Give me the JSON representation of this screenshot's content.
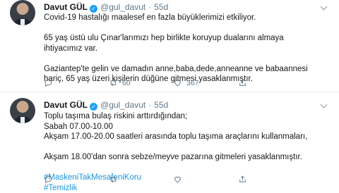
{
  "tweets": [
    {
      "author_name": "Davut GÜL",
      "handle": "@gul_davut",
      "dot": "·",
      "time": "55d",
      "lines": [
        "Covid-19 hastalığı maalesef en fazla büyüklerimizi etkiliyor.",
        "",
        "65 yaş üstü ulu Çınar'larımızı hep birlikte koruyup dualarını almaya",
        "ihtiyacımız var.",
        "",
        "Gaziantep'te gelin ve damadın anne,baba,dede,anneanne ve babaannesi",
        "hariç, 65 yaş üzeri kişilerin düğüne gitmesi yasaklanmıştır."
      ],
      "hashtags": [],
      "actions": {
        "reply_count": "",
        "retweet_count": "60",
        "like_count": "367"
      }
    },
    {
      "author_name": "Davut GÜL",
      "handle": "@gul_davut",
      "dot": "·",
      "time": "55d",
      "lines": [
        "Toplu taşıma bulaş riskini arttırdığından;",
        "Sabah 07.00-10.00",
        "Akşam 17.00-20.00 saatleri arasında toplu taşıma araçlarını kullanmaları,",
        "",
        "Akşam 18.00'dan sonra sebze/meyve pazarına gitmeleri yasaklanmıştır.",
        ""
      ],
      "hashtags": [
        "#MaskeniTakMesafeniKoru",
        "#Temizlik"
      ],
      "actions": {
        "reply_count": "",
        "retweet_count": "",
        "like_count": ""
      }
    }
  ],
  "icons": {
    "verified": "verified-badge-icon",
    "reply": "reply-icon",
    "retweet": "retweet-icon",
    "like": "heart-icon",
    "share": "share-icon",
    "more": "chevron-down-icon"
  },
  "colors": {
    "link": "#1b95e0",
    "meta": "#657786",
    "verified": "#1da1f2"
  }
}
